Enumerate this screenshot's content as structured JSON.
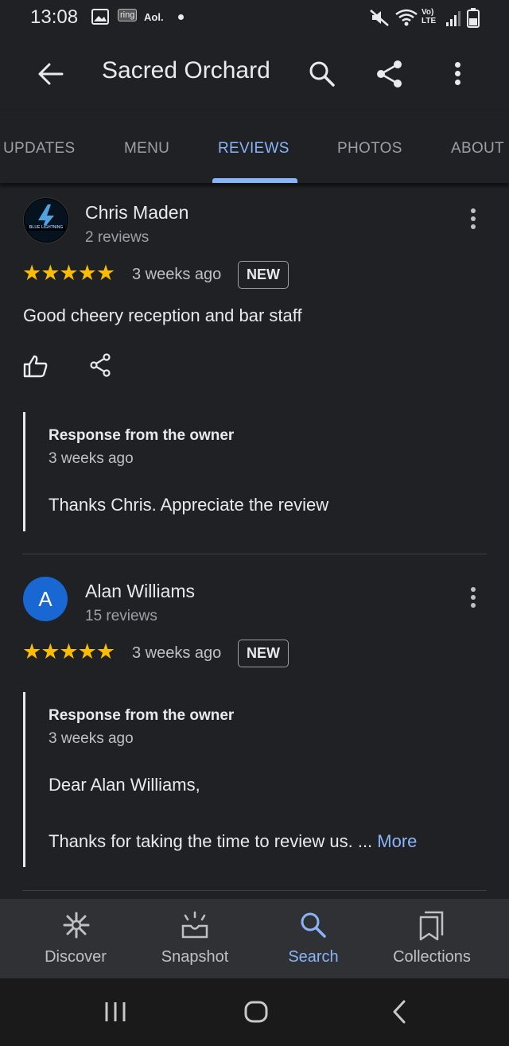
{
  "status_bar": {
    "time": "13:08",
    "ring_label": "ring",
    "aol_label": "Aol.",
    "lte_label": "Vo) LTE"
  },
  "app_bar": {
    "title": "Sacred Orchard"
  },
  "tabs": [
    {
      "label": "UPDATES",
      "active": false
    },
    {
      "label": "MENU",
      "active": false
    },
    {
      "label": "REVIEWS",
      "active": true
    },
    {
      "label": "PHOTOS",
      "active": false
    },
    {
      "label": "ABOUT",
      "active": false
    }
  ],
  "reviews": [
    {
      "name": "Chris Maden",
      "count": "2 reviews",
      "stars": "★★★★★",
      "rating": 5,
      "time": "3 weeks ago",
      "badge": "NEW",
      "text": "Good cheery reception and bar staff",
      "avatar_text": "BLUE LIGHTNING",
      "response": {
        "title": "Response from the owner",
        "time": "3 weeks ago",
        "text": "Thanks Chris. Appreciate the review"
      }
    },
    {
      "name": "Alan Williams",
      "count": "15 reviews",
      "stars": "★★★★★",
      "rating": 5,
      "time": "3 weeks ago",
      "badge": "NEW",
      "avatar_letter": "A",
      "avatar_color": "#1967d2",
      "response": {
        "title": "Response from the owner",
        "time": "3 weeks ago",
        "line1": "Dear Alan Williams,",
        "line2": "Thanks for taking the time to review us. ...",
        "more_label": "More"
      }
    }
  ],
  "bottom_nav": [
    {
      "label": "Discover",
      "icon": "discover-icon",
      "active": false
    },
    {
      "label": "Snapshot",
      "icon": "snapshot-icon",
      "active": false
    },
    {
      "label": "Search",
      "icon": "search-icon",
      "active": true
    },
    {
      "label": "Collections",
      "icon": "collections-icon",
      "active": false
    }
  ],
  "colors": {
    "accent": "#8ab4f8",
    "star": "#fbbc04",
    "background": "#202124"
  }
}
